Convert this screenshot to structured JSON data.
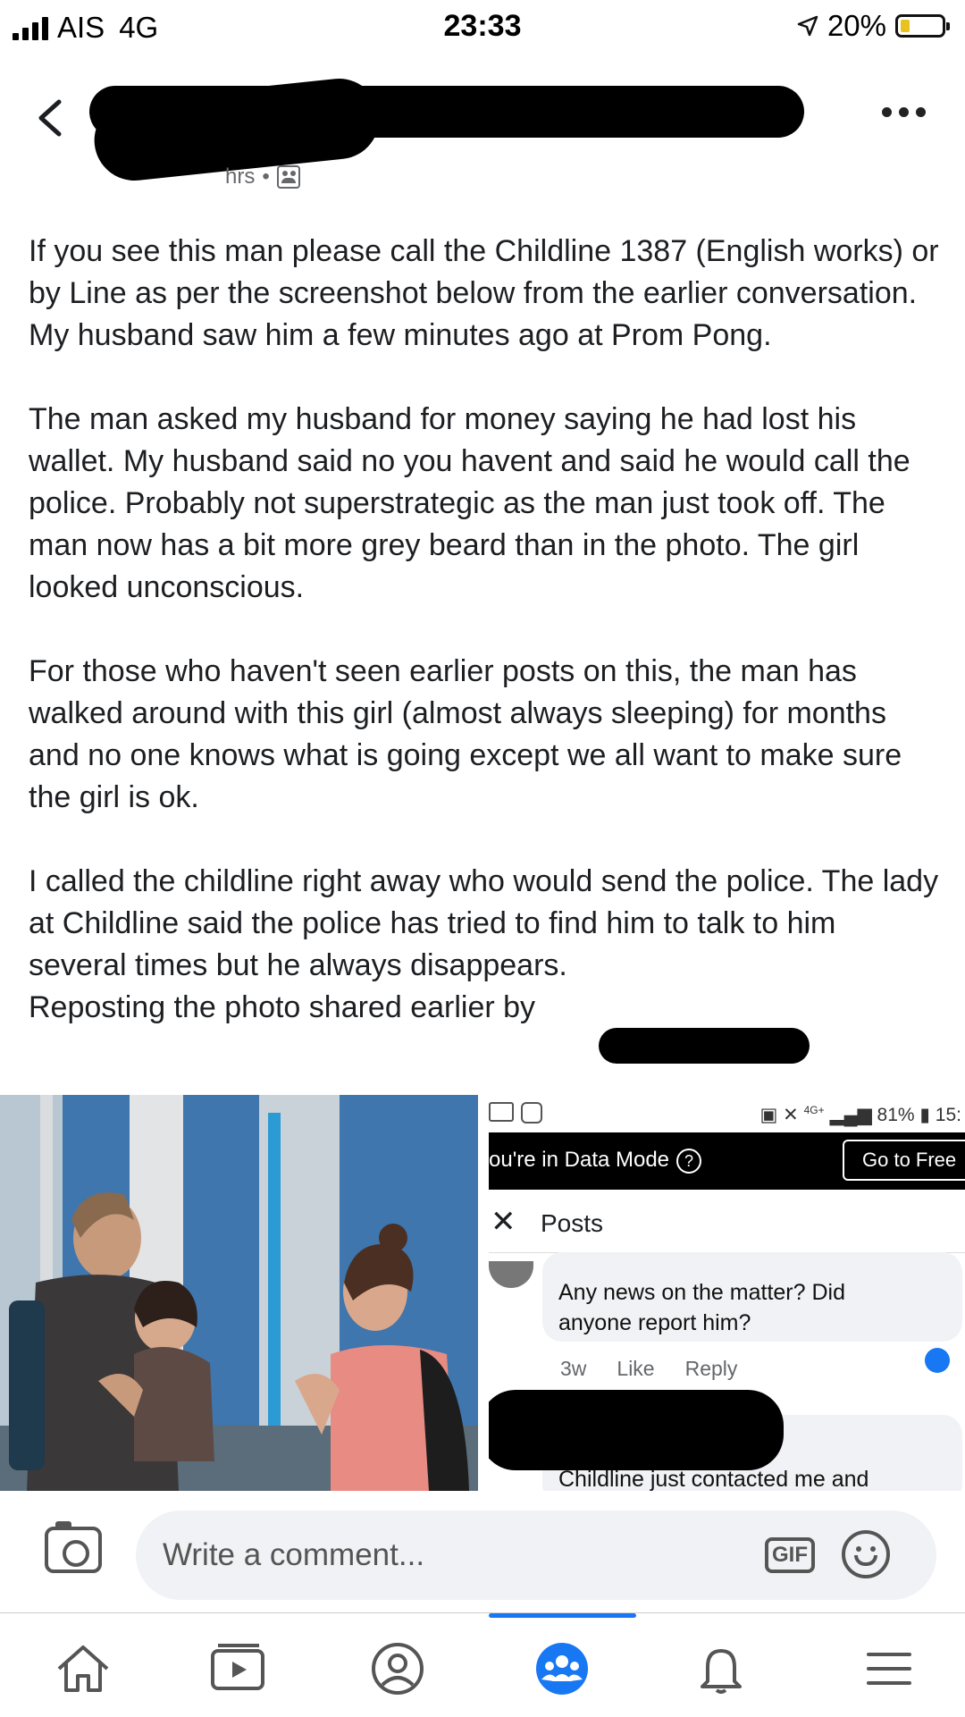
{
  "status_bar": {
    "carrier": "AIS",
    "network": "4G",
    "time": "23:33",
    "battery": "20%"
  },
  "post": {
    "meta_time": "hrs",
    "paragraphs": [
      "If you see this man please call the Childline 1387 (English works) or by Line as per the screenshot below from the earlier conversation. My husband saw him a few minutes ago at Prom Pong.",
      "The man asked my husband for money saying he had lost his wallet. My husband said no you havent and said he would call the police. Probably not superstrategic as the man just took off. The man now has a bit more grey beard than in the photo. The girl looked unconscious.",
      "For those who haven't seen earlier posts on this, the man has  walked around with this girl (almost always sleeping) for months and no one knows what is going except we all want to make sure the girl is ok.",
      "I called the childline right away who would send the police. The lady at Childline said the police has tried to find him to talk to him several times but he always disappears.\nReposting the photo shared earlier by"
    ]
  },
  "embedded_screenshot": {
    "status_battery": "81%",
    "status_time": "15:",
    "status_network": "4G+",
    "data_mode_text": "ou're in Data Mode",
    "go_to_free": "Go to Free",
    "posts_label": "Posts",
    "comment_text": "Any news on the matter? Did\nanyone report him?",
    "comment_time": "3w",
    "like": "Like",
    "reply": "Reply",
    "comment2_text": "Childline just contacted me and"
  },
  "comment_bar": {
    "placeholder": "Write a comment...",
    "gif_label": "GIF"
  },
  "tabs": [
    "home",
    "watch",
    "profile",
    "groups",
    "notifications",
    "menu"
  ],
  "colors": {
    "accent": "#1877f2",
    "text": "#1c1e21",
    "muted": "#65676b",
    "input_bg": "#f0f2f5"
  }
}
